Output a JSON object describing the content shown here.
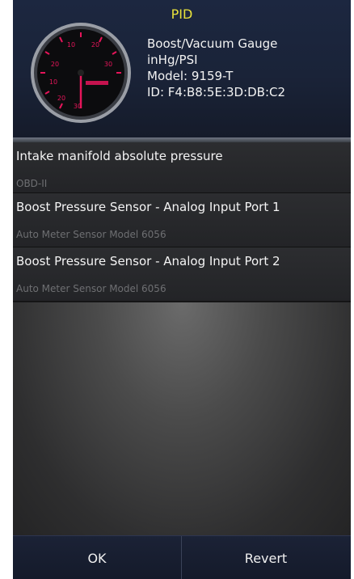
{
  "header": {
    "title": "PID",
    "device": {
      "name": "Boost/Vacuum Gauge",
      "units": "inHg/PSI",
      "model": "Model: 9159-T",
      "id": "ID: F4:B8:5E:3D:DB:C2"
    },
    "gauge": {
      "tick_labels": [
        "10",
        "20",
        "30",
        "20",
        "10",
        "20",
        "30"
      ],
      "accent_color": "#e6155a"
    }
  },
  "list": [
    {
      "title": "Intake manifold absolute pressure",
      "subtitle": "OBD-II"
    },
    {
      "title": "Boost Pressure Sensor - Analog Input Port 1",
      "subtitle": "Auto Meter Sensor Model 6056"
    },
    {
      "title": "Boost Pressure Sensor - Analog Input Port 2",
      "subtitle": "Auto Meter Sensor Model 6056"
    }
  ],
  "footer": {
    "ok_label": "OK",
    "revert_label": "Revert"
  },
  "colors": {
    "title_yellow": "#e9e23b",
    "header_navy": "#1c2740",
    "footer_navy": "#1b2236"
  }
}
